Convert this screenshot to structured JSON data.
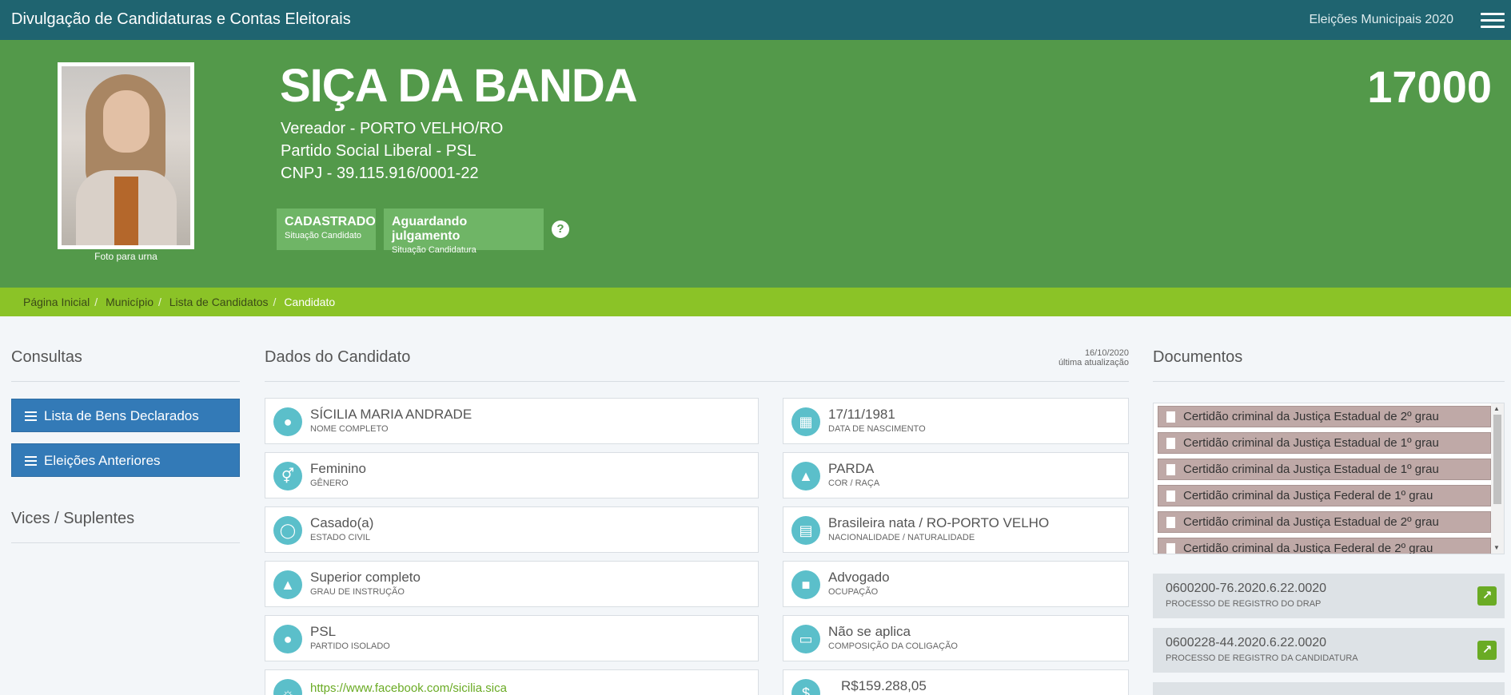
{
  "topbar": {
    "title": "Divulgação de Candidaturas e Contas Eleitorais",
    "election": "Eleições Municipais 2020"
  },
  "candidate": {
    "name": "SIÇA DA BANDA",
    "office": "Vereador - PORTO VELHO/RO",
    "party": "Partido Social Liberal - PSL",
    "cnpj": "CNPJ - 39.115.916/0001-22",
    "number": "17000",
    "photo_caption": "Foto para urna",
    "badges": [
      {
        "main": "CADASTRADO",
        "sub": "Situação Candidato"
      },
      {
        "main": "Aguardando julgamento",
        "sub": "Situação Candidatura"
      }
    ],
    "help": "?"
  },
  "breadcrumb": [
    "Página Inicial",
    "Município",
    "Lista de Candidatos",
    "Candidato"
  ],
  "left": {
    "title": "Consultas",
    "buttons": [
      "Lista de Bens Declarados",
      "Eleições Anteriores"
    ],
    "vices_title": "Vices / Suplentes"
  },
  "dados": {
    "title": "Dados do Candidato",
    "update_date": "16/10/2020",
    "update_label": "última atualização",
    "left_cards": [
      {
        "value": "SÍCILIA MARIA ANDRADE",
        "label": "NOME COMPLETO"
      },
      {
        "value": "Feminino",
        "label": "GÊNERO"
      },
      {
        "value": "Casado(a)",
        "label": "ESTADO CIVIL"
      },
      {
        "value": "Superior completo",
        "label": "GRAU DE INSTRUÇÃO"
      },
      {
        "value": "PSL",
        "label": "PARTIDO ISOLADO"
      },
      {
        "value": "https://www.facebook.com/sicilia.sica",
        "label": ""
      }
    ],
    "right_cards": [
      {
        "value": "17/11/1981",
        "label": "DATA DE NASCIMENTO"
      },
      {
        "value": "PARDA",
        "label": "COR / RAÇA"
      },
      {
        "value": "Brasileira nata / RO-PORTO VELHO",
        "label": "NACIONALIDADE / NATURALIDADE"
      },
      {
        "value": "Advogado",
        "label": "OCUPAÇÃO"
      },
      {
        "value": "Não se aplica",
        "label": "COMPOSIÇÃO DA COLIGAÇÃO"
      },
      {
        "value": "R$159.288,05",
        "label": ""
      }
    ]
  },
  "documentos": {
    "title": "Documentos",
    "items": [
      "Certidão criminal da Justiça Estadual de 2º grau",
      "Certidão criminal da Justiça Estadual de 1º grau",
      "Certidão criminal da Justiça Estadual de 1º grau",
      "Certidão criminal da Justiça Federal de 1º grau",
      "Certidão criminal da Justiça Estadual de 2º grau",
      "Certidão criminal da Justiça Federal de 2º grau"
    ],
    "processes": [
      {
        "number": "0600200-76.2020.6.22.0020",
        "label": "PROCESSO DE REGISTRO DO DRAP"
      },
      {
        "number": "0600228-44.2020.6.22.0020",
        "label": "PROCESSO DE REGISTRO DA CANDIDATURA"
      }
    ]
  },
  "colors": {
    "topbar": "#1f6470",
    "header": "#53994a",
    "breadcrumb": "#8bc327",
    "button": "#337ab7",
    "icon": "#5bbfca"
  }
}
